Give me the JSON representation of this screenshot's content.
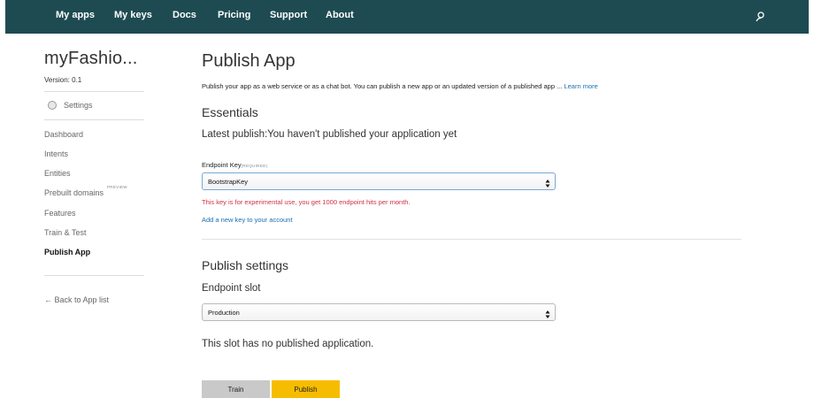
{
  "nav": {
    "items": [
      "My apps",
      "My keys",
      "Docs",
      "Pricing",
      "Support",
      "About"
    ],
    "user_icon": "user-icon"
  },
  "sidebar": {
    "app_name": "myFashio...",
    "version": "Version: 0.1",
    "settings_label": "Settings",
    "items": [
      {
        "label": "Dashboard"
      },
      {
        "label": "Intents"
      },
      {
        "label": "Entities"
      },
      {
        "label": "Prebuilt domains",
        "badge": "PREVIEW"
      },
      {
        "label": "Features"
      },
      {
        "label": "Train & Test"
      },
      {
        "label": "Publish App",
        "active": true
      }
    ],
    "back_link": "← Back to App list"
  },
  "main": {
    "title": "Publish App",
    "description": "Publish your app as a web service or as a chat bot. You can publish a new app or an updated version of a published app ...",
    "learn_more": "Learn more",
    "essentials_heading": "Essentials",
    "latest_publish": "Latest publish:You haven't published your application yet",
    "endpoint_key_label": "Endpoint Key",
    "endpoint_key_required": "(REQUIRED)",
    "endpoint_key_value": "BootstrapKey",
    "warning": "This key is for experimental use, you get 1000 endpoint hits per month.",
    "add_key_link": "Add a new key to your account",
    "publish_settings_heading": "Publish settings",
    "endpoint_slot_label": "Endpoint slot",
    "endpoint_slot_value": "Production",
    "no_published": "This slot has no published application.",
    "train_button": "Train",
    "publish_button": "Publish"
  },
  "colors": {
    "topbar": "#1e4b52",
    "link": "#1a6fb3",
    "warning": "#d0314b",
    "publish_button": "#f6bd00",
    "train_button": "#c9c9c9"
  }
}
